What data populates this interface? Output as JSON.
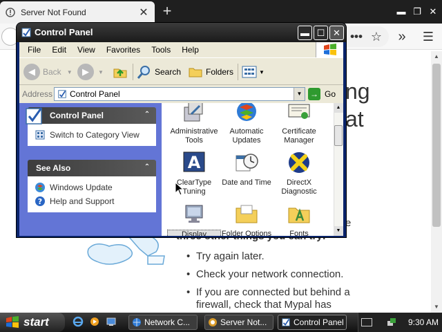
{
  "browser": {
    "tab_title": "Server Not Found",
    "error_title_line1_fragment": "ng",
    "error_title_line2_fragment": "at",
    "text_fragment_e": "e",
    "try_line": "three other things you can try:",
    "suggestions": [
      "Try again later.",
      "Check your network connection.",
      "If you are connected but behind a firewall, check that Mypal has"
    ]
  },
  "cp_window": {
    "title": "Control Panel",
    "menu": [
      "File",
      "Edit",
      "View",
      "Favorites",
      "Tools",
      "Help"
    ],
    "toolbar": {
      "back": "Back",
      "search": "Search",
      "folders": "Folders"
    },
    "address_label": "Address",
    "address_value": "Control Panel",
    "go_label": "Go",
    "task_pane": {
      "control_panel": {
        "title": "Control Panel",
        "links": [
          "Switch to Category View"
        ]
      },
      "see_also": {
        "title": "See Also",
        "links": [
          "Windows Update",
          "Help and Support"
        ]
      }
    },
    "items": [
      {
        "label": "Administrative Tools",
        "icon": "administrative-tools-icon"
      },
      {
        "label": "Automatic Updates",
        "icon": "automatic-updates-icon"
      },
      {
        "label": "Certificate Manager",
        "icon": "certificate-manager-icon"
      },
      {
        "label": "ClearType Tuning",
        "icon": "cleartype-icon"
      },
      {
        "label": "Date and Time",
        "icon": "date-time-icon"
      },
      {
        "label": "DirectX Diagnostic",
        "icon": "directx-icon"
      },
      {
        "label": "Display",
        "icon": "display-icon"
      },
      {
        "label": "Folder Options",
        "icon": "folder-options-icon"
      },
      {
        "label": "Fonts",
        "icon": "fonts-icon"
      }
    ]
  },
  "taskbar": {
    "start_label": "start",
    "tasks": [
      "Network C...",
      "Server Not...",
      "Control Panel"
    ],
    "clock": "9:30 AM"
  }
}
